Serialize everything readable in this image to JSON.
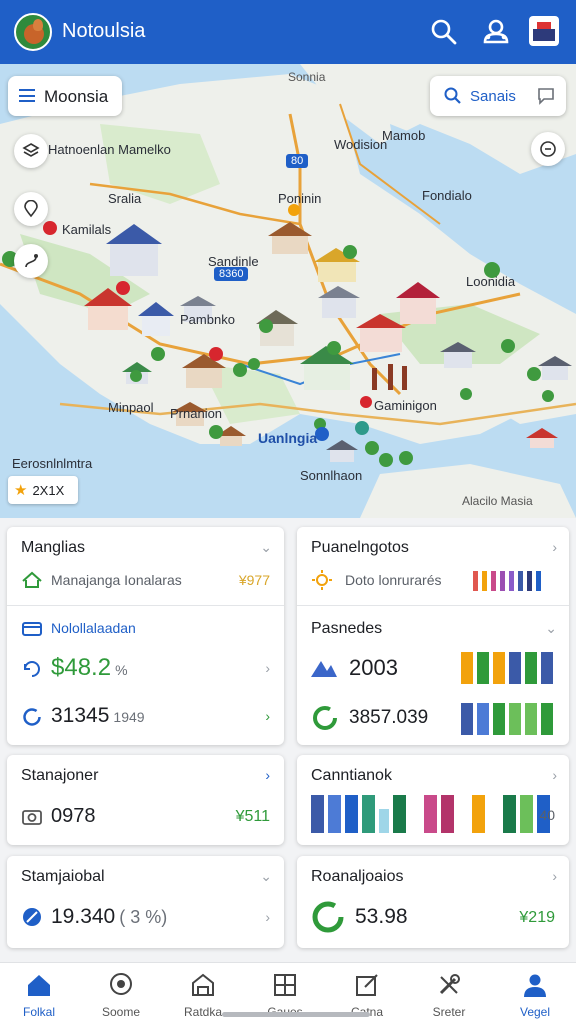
{
  "header": {
    "title": "Notoulsia"
  },
  "map": {
    "menu_label": "Moonsia",
    "search_label": "Sanais",
    "labels": {
      "top": "Sonnia",
      "a": "Hatnoenlan Mamelko",
      "b": "Mamob",
      "c": "Wodision",
      "d": "Poninin",
      "e": "Fondialo",
      "f": "Sralia",
      "g": "Kamilals",
      "h": "Loonidia",
      "i": "Sandinle",
      "j": "Pambnko",
      "k": "Gaminigon",
      "l": "Minpaol",
      "m": "Prnanion",
      "n": "Uanlngia",
      "o": "Sonnlhaon",
      "p": "Alacilo Masia",
      "q": "Eerosnlnlmtra"
    },
    "badges": {
      "b1": "80",
      "b2": "8360"
    },
    "rating": "2X1X"
  },
  "cards": {
    "c1": {
      "title": "Manglias",
      "row_label": "Manajanga Ionalaras",
      "row_value": "¥977"
    },
    "c2": {
      "title": "Nolollalaadan",
      "value1": "$48.2",
      "value1_sub": "%",
      "value2": "31345",
      "value2_sub": "1949"
    },
    "c3": {
      "title": "Puanelngotos",
      "row_label": "Doto lonrurarés"
    },
    "c4": {
      "title": "Pasnedes",
      "value1": "2003",
      "value2": "3857.039"
    },
    "c5": {
      "title": "Stanajoner",
      "value": "0978",
      "right_value": "¥511"
    },
    "c6": {
      "title": "Canntianok",
      "right_value": "40"
    },
    "c7": {
      "title": "Stamjaiobal",
      "value": "19.340",
      "sub": "( 3 %)"
    },
    "c8": {
      "title": "Roanaljoaios",
      "value": "53.98",
      "right_value": "¥219"
    }
  },
  "nav": [
    "Folkal",
    "Soome",
    "Ratdka",
    "Gaues",
    "Catna",
    "Sreter",
    "Vegel"
  ],
  "colors": {
    "accent": "#1f5fc7",
    "green": "#2f9a3a"
  }
}
